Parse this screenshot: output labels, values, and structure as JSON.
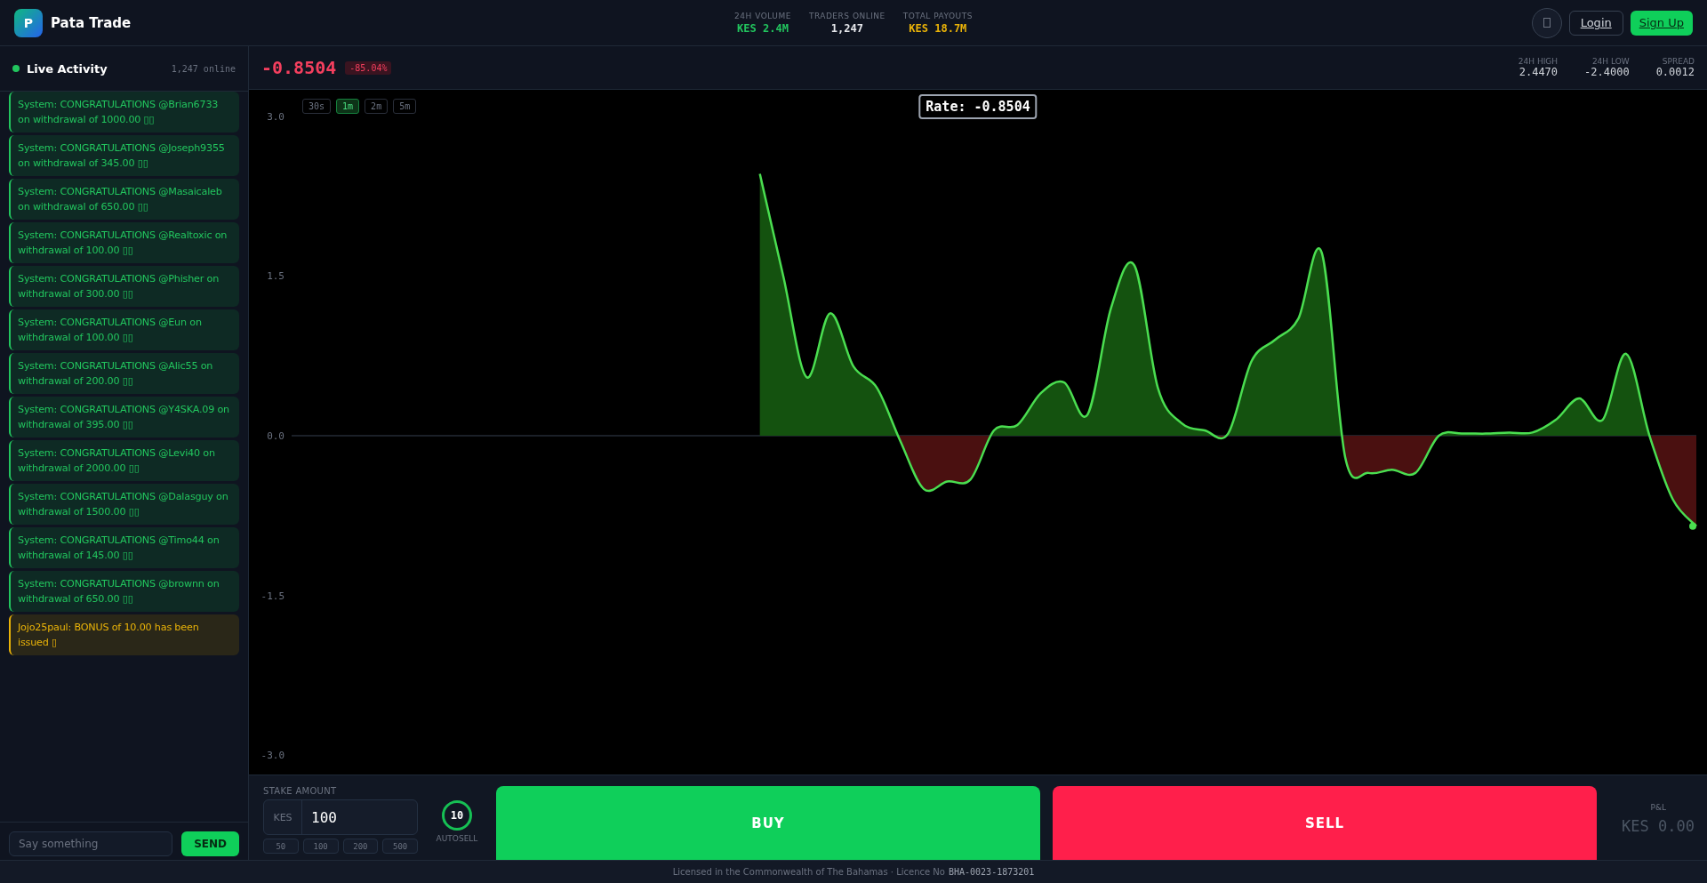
{
  "header": {
    "brand": {
      "initial": "P",
      "name": "Pata Trade"
    },
    "stats": [
      {
        "label": "24H VOLUME",
        "value": "KES 2.4M",
        "color": "#22c55e"
      },
      {
        "label": "TRADERS ONLINE",
        "value": "1,247",
        "color": "#e5e7eb"
      },
      {
        "label": "TOTAL PAYOUTS",
        "value": "KES 18.7M",
        "color": "#eab308"
      }
    ],
    "actions": [
      "Login",
      "Sign Up"
    ]
  },
  "activity": {
    "title": "Live Activity",
    "online": "1,247 online",
    "messages": [
      {
        "kind": "system",
        "text": "System: CONGRATULATIONS @Brian6733 on withdrawal of 1000.00 ▯▯"
      },
      {
        "kind": "system",
        "text": "System: CONGRATULATIONS @Joseph9355 on withdrawal of 345.00 ▯▯"
      },
      {
        "kind": "system",
        "text": "System: CONGRATULATIONS @Masaicaleb on withdrawal of 650.00 ▯▯"
      },
      {
        "kind": "system",
        "text": "System: CONGRATULATIONS @Realtoxic on withdrawal of 100.00 ▯▯"
      },
      {
        "kind": "system",
        "text": "System: CONGRATULATIONS @Phisher on withdrawal of 300.00 ▯▯"
      },
      {
        "kind": "system",
        "text": "System: CONGRATULATIONS @Eun on withdrawal of 100.00 ▯▯"
      },
      {
        "kind": "system",
        "text": "System: CONGRATULATIONS @Alic55 on withdrawal of 200.00 ▯▯"
      },
      {
        "kind": "system",
        "text": "System: CONGRATULATIONS @Y4SKA.09 on withdrawal of 395.00 ▯▯"
      },
      {
        "kind": "system",
        "text": "System: CONGRATULATIONS @Levi40 on withdrawal of 2000.00 ▯▯"
      },
      {
        "kind": "system",
        "text": "System: CONGRATULATIONS @Dalasguy on withdrawal of 1500.00 ▯▯"
      },
      {
        "kind": "system",
        "text": "System: CONGRATULATIONS @Timo44 on withdrawal of 145.00 ▯▯"
      },
      {
        "kind": "system",
        "text": "System: CONGRATULATIONS @brownn on withdrawal of 650.00 ▯▯"
      },
      {
        "kind": "bonus",
        "text": "Jojo25paul: BONUS of 10.00 has been issued ▯"
      }
    ],
    "input": {
      "placeholder": "Say something"
    },
    "send": "SEND"
  },
  "price": {
    "rate": "-0.8504",
    "change": "-85.04%",
    "stats": [
      {
        "label": "24H HIGH",
        "value": "2.4470"
      },
      {
        "label": "24H LOW",
        "value": "-2.4000"
      },
      {
        "label": "SPREAD",
        "value": "0.0012"
      }
    ]
  },
  "chart": {
    "timeframes": [
      {
        "label": "30s",
        "selected": false
      },
      {
        "label": "1m",
        "selected": true
      },
      {
        "label": "2m",
        "selected": false
      },
      {
        "label": "5m",
        "selected": false
      }
    ],
    "rate_label": "Rate: -0.8504",
    "chart_data": {
      "type": "area",
      "ylim": [
        -3,
        3
      ],
      "yticks": [
        {
          "value": 3,
          "label": "3.0"
        },
        {
          "value": 1.5,
          "label": "1.5"
        },
        {
          "value": 0,
          "label": "0.0"
        },
        {
          "value": -1.5,
          "label": "-1.5"
        },
        {
          "value": -3,
          "label": "-3.0"
        }
      ],
      "series": [
        {
          "color": "#4ade50",
          "values": [
            null,
            null,
            null,
            null,
            null,
            null,
            null,
            null,
            null,
            null,
            null,
            null,
            null,
            null,
            null,
            null,
            null,
            null,
            null,
            null,
            2.46,
            1.5,
            0.55,
            1.15,
            0.65,
            0.45,
            -0.05,
            -0.5,
            -0.43,
            -0.41,
            0.05,
            0.1,
            0.4,
            0.5,
            0.2,
            1.2,
            1.6,
            0.45,
            0.12,
            0.05,
            0.02,
            0.7,
            0.9,
            1.1,
            1.72,
            -0.2,
            -0.35,
            -0.32,
            -0.35,
            0.0,
            0.02,
            0.02,
            0.03,
            0.03,
            0.15,
            0.35,
            0.15,
            0.77,
            0.0,
            -0.6,
            -0.85
          ]
        }
      ]
    }
  },
  "trade": {
    "stake_label": "STAKE AMOUNT",
    "currency": "KES",
    "amount": "100",
    "quick": [
      "50",
      "100",
      "200",
      "500"
    ],
    "autosell": {
      "value": "10",
      "label": "AUTOSELL"
    },
    "buy": "BUY",
    "sell": "SELL",
    "pnl": {
      "label": "P&L",
      "value": "KES 0.00"
    }
  },
  "footer": {
    "text": "Licensed in the Commonwealth of The Bahamas · Licence No",
    "licence": "BHA-0023-1873201"
  }
}
